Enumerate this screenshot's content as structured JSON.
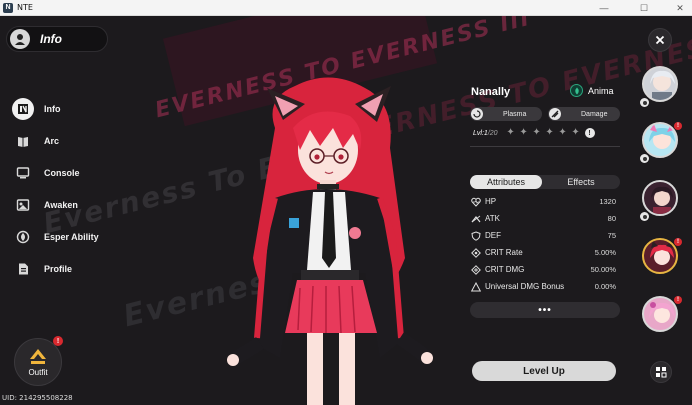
{
  "window": {
    "title": "NTE",
    "minimize_glyph": "—",
    "maximize_glyph": "☐",
    "close_glyph": "✕"
  },
  "background": {
    "stripe_text_1": "EVERNESS TO EVERNESS III",
    "stripe_text_2": "EVERNESS TO EVERNESS",
    "stripe_text_3": "Everness To Ev"
  },
  "header": {
    "label": "Info",
    "icon": "character-head-icon"
  },
  "menu": {
    "items": [
      {
        "label": "Info",
        "icon": "info-badge-icon",
        "active": true
      },
      {
        "label": "Arc",
        "icon": "arc-book-icon",
        "active": false
      },
      {
        "label": "Console",
        "icon": "console-screen-icon",
        "active": false
      },
      {
        "label": "Awaken",
        "icon": "awaken-panel-icon",
        "active": false
      },
      {
        "label": "Esper Ability",
        "icon": "esper-spiral-icon",
        "active": false
      },
      {
        "label": "Profile",
        "icon": "profile-card-icon",
        "active": false
      }
    ]
  },
  "outfit": {
    "label": "Outfit",
    "badge": "!"
  },
  "uid": "UID: 214295508228",
  "character": {
    "name": "Nanally",
    "affiliation": "Anima",
    "tags": [
      {
        "label": "Plasma",
        "icon": "plasma-swirl-icon"
      },
      {
        "label": "Damage",
        "icon": "damage-slash-icon"
      }
    ],
    "level_label": "Lvl:",
    "level_current": "1",
    "level_max": "/20",
    "stars_total": 6,
    "stars_filled": 0
  },
  "tabs": {
    "attributes": "Attributes",
    "effects": "Effects"
  },
  "stats": [
    {
      "name": "HP",
      "value": "1320",
      "icon": "heart-pulse-icon"
    },
    {
      "name": "ATK",
      "value": "80",
      "icon": "atk-chevron-icon"
    },
    {
      "name": "DEF",
      "value": "75",
      "icon": "shield-icon"
    },
    {
      "name": "CRIT Rate",
      "value": "5.00%",
      "icon": "crit-rate-diamond-icon"
    },
    {
      "name": "CRIT DMG",
      "value": "50.00%",
      "icon": "crit-dmg-diamond-icon"
    },
    {
      "name": "Universal DMG Bonus",
      "value": "0.00%",
      "icon": "triangle-warning-icon"
    }
  ],
  "more_label": "•••",
  "level_up_label": "Level Up",
  "roster": {
    "badge": "!",
    "colors": {
      "accent_gold": "#e7b542",
      "alert_red": "#d8292f",
      "brand_pink": "#8c2846"
    }
  }
}
